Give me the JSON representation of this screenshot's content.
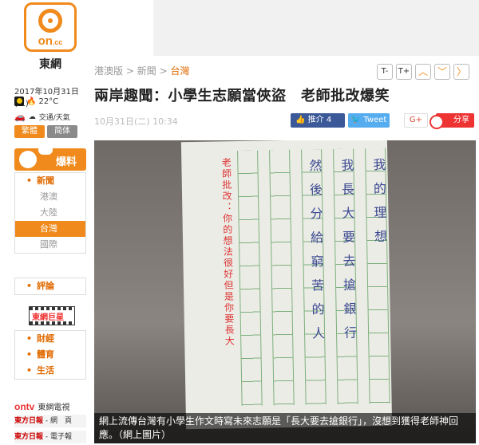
{
  "brand": {
    "logo_main": "on",
    "logo_sub": ".cc",
    "name": "東網"
  },
  "sidebar": {
    "date": "2017年10月31日 (二)",
    "temperature": "22°C",
    "traffic_label": "交通/天氣",
    "lang_traditional": "繁體",
    "lang_simplified": "简体",
    "baoliao": "爆料",
    "nav": {
      "news": "新聞",
      "sub": [
        "港澳",
        "大陸",
        "台灣",
        "國際"
      ]
    },
    "nav2": [
      "評論"
    ],
    "star_label": "東網巨星",
    "nav3": [
      "財經",
      "體育",
      "生活"
    ],
    "ontv_logo": "ontv",
    "ontv_label": "東網電視",
    "promos": [
      {
        "a": "東方日報",
        "b": "- 網　頁"
      },
      {
        "a": "東方日報",
        "b": "- 電子報"
      }
    ]
  },
  "breadcrumb": {
    "edition": "港澳版",
    "section": "新聞",
    "current": "台灣",
    "sep": ">"
  },
  "tools": {
    "font_smaller": "T-",
    "font_larger": "T+",
    "up": "︿",
    "down": "﹀",
    "next": "〉"
  },
  "article": {
    "title": "兩岸趣聞：小學生志願當俠盜　老師批改爆笑",
    "meta": "10月31日(二) 10:34",
    "share_fb": "推介 4",
    "share_tw": "Tweet",
    "share_gp": "G+",
    "share_wb": "分享",
    "caption": "網上流傳台灣有小學生作文時寫未來志願是「長大要去搶銀行」，沒想到獲得老師神回應。（網上圖片）"
  },
  "handwriting": {
    "col1": "我的理想",
    "col2": "我長大要去搶銀行",
    "col3": "然後分給窮苦的人",
    "teacher": "老師批改：你的想法很好但是你要長大"
  },
  "colors": {
    "accent": "#f08a1c",
    "facebook": "#3b5998",
    "twitter": "#55acee",
    "weibo": "#e33333"
  }
}
